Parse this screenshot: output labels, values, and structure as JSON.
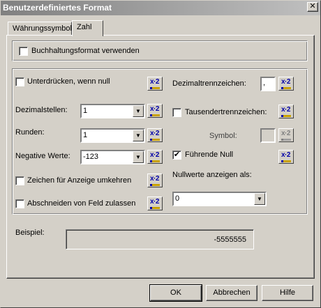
{
  "window": {
    "title": "Benutzerdefiniertes Format",
    "close_glyph": "✕"
  },
  "tabs": [
    {
      "label": "Währungssymbol"
    },
    {
      "label": "Zahl"
    }
  ],
  "accounting": {
    "label": "Buchhaltungsformat verwenden",
    "checked": false
  },
  "left": {
    "suppress_zero": {
      "label": "Unterdrücken, wenn null",
      "checked": false
    },
    "decimal_places": {
      "label": "Dezimalstellen:",
      "value": "1"
    },
    "rounding": {
      "label": "Runden:",
      "value": "1"
    },
    "negative_values": {
      "label": "Negative Werte:",
      "value": "-123"
    },
    "reverse_sign": {
      "label": "Zeichen für Anzeige umkehren",
      "checked": false
    },
    "truncate": {
      "label": "Abschneiden von Feld zulassen",
      "checked": false
    }
  },
  "right": {
    "decimal_separator": {
      "label": "Dezimaltrennzeichen:",
      "value": ","
    },
    "thousands_separator": {
      "label": "Tausendertrennzeichen:",
      "checked": false
    },
    "symbol": {
      "label": "Symbol:",
      "value": ""
    },
    "leading_zero": {
      "label": "Führende Null",
      "checked": true
    },
    "show_zero_as": {
      "label": "Nullwerte anzeigen als:",
      "value": "0"
    }
  },
  "icon_button_text": "x·2",
  "sample": {
    "label": "Beispiel:",
    "value": "-5555555"
  },
  "buttons": {
    "ok": "OK",
    "cancel": "Abbrechen",
    "help": "Hilfe"
  },
  "checkmark": "✔",
  "arrow_glyph": "▼"
}
